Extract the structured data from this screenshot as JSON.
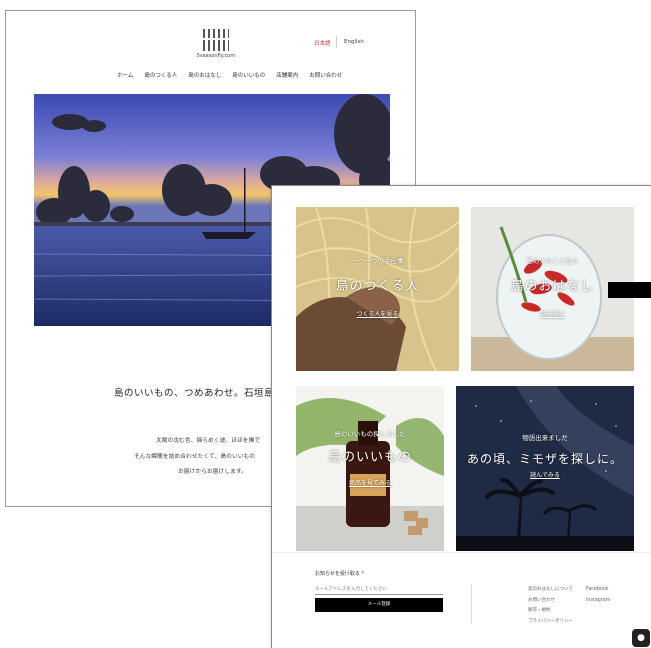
{
  "back_page": {
    "logo_text": "5seasonfly.com",
    "lang": {
      "ja": "日本語",
      "en": "English"
    },
    "nav": [
      "ホーム",
      "島のつくる人",
      "島のおはなし",
      "島のいいもの",
      "店舗案内",
      "お問い合わせ"
    ],
    "tagline": "島のいいもの、つめあわせ。石垣島",
    "intro": [
      "太陽の沈む色、揺らめく波、ほほを撫で",
      "そんな瞬間を詰め合わせたくて、島のいいもの",
      "お届けからお届けします。"
    ]
  },
  "front_page": {
    "tiles": [
      {
        "sub": "ーつ一つの手仕事",
        "title": "島のつくる人",
        "link": "つくる人を見る"
      },
      {
        "sub": "島の人のこと色々",
        "title": "島のおはなし",
        "link": "話を読む"
      },
      {
        "sub": "島のいいもの探しました",
        "title": "島のいいもの",
        "link": "商品を見てみる"
      },
      {
        "sub": "物語出来ました",
        "title": "あの頃、ミモザを探しに。",
        "link": "読んでみる"
      }
    ],
    "contact": {
      "label": "お知らせを受け取る *",
      "placeholder": "メールアドレスを入力してください",
      "button": "メール登録"
    },
    "footer_links": [
      "島のおはなしについて",
      "お問い合わせ",
      "販売・規約",
      "プライバシーポリシー"
    ],
    "social": [
      "Facebook",
      "Instagram"
    ],
    "chat_icon": "chat-icon"
  }
}
